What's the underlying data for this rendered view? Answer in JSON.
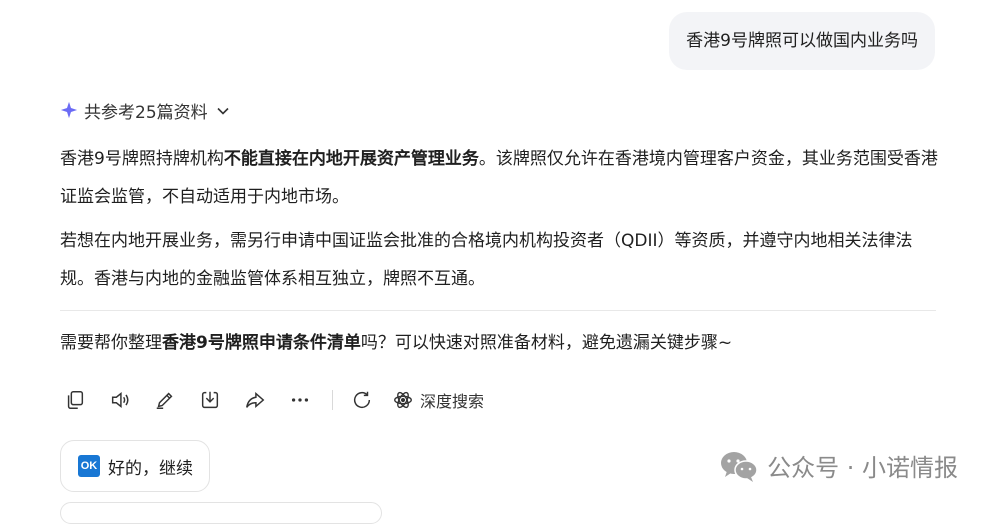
{
  "user_message": "香港9号牌照可以做国内业务吗",
  "references": {
    "label": "共参考25篇资料"
  },
  "answer": {
    "p1_before": "香港9号牌照持牌机构",
    "p1_bold": "不能直接在内地开展资产管理业务",
    "p1_after": "。该牌照仅允许在香港境内管理客户资金，其业务范围受香港证监会监管，不自动适用于内地市场。",
    "p2": "若想在内地开展业务，需另行申请中国证监会批准的合格境内机构投资者（QDII）等资质，并遵守内地相关法律法规。香港与内地的金融监管体系相互独立，牌照不互通。"
  },
  "suggestion": {
    "before": "需要帮你整理",
    "bold": "香港9号牌照申请条件清单",
    "after": "吗？可以快速对照准备材料，避免遗漏关键步骤~"
  },
  "toolbar": {
    "icons": [
      "copy-icon",
      "speaker-icon",
      "edit-icon",
      "download-icon",
      "share-icon",
      "more-icon",
      "regenerate-icon",
      "deep-search-icon"
    ],
    "deep_search_label": "深度搜索"
  },
  "quick_reply": {
    "badge": "OK",
    "label": "好的，继续"
  },
  "watermark": {
    "text": "公众号 · 小诺情报"
  },
  "colors": {
    "accent": "#6b6bf5",
    "bubble_bg": "#f3f4f7",
    "ok_badge": "#1877d4"
  }
}
